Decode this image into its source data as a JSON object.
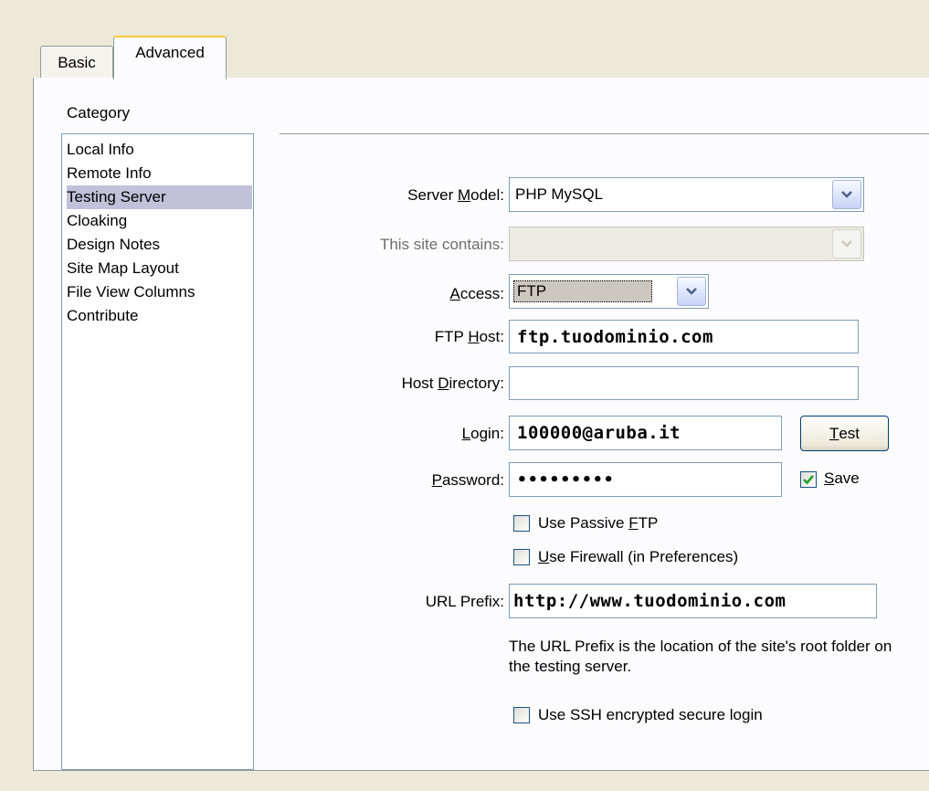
{
  "tabs": {
    "basic": "Basic",
    "advanced": "Advanced"
  },
  "category": {
    "label": "Category",
    "items": [
      "Local Info",
      "Remote Info",
      "Testing Server",
      "Cloaking",
      "Design Notes",
      "Site Map Layout",
      "File View Columns",
      "Contribute"
    ],
    "selected": "Testing Server"
  },
  "form": {
    "server_model": {
      "label_pre": "Server ",
      "label_u": "M",
      "label_post": "odel:",
      "value": "PHP MySQL"
    },
    "site_contains": {
      "label": "This site contains:",
      "value": ""
    },
    "access": {
      "label_u": "A",
      "label_post": "ccess:",
      "value": "FTP"
    },
    "ftp_host": {
      "label_pre": "FTP ",
      "label_u": "H",
      "label_post": "ost:",
      "value": "ftp.tuodominio.com"
    },
    "host_directory": {
      "label_pre": "Host ",
      "label_u": "D",
      "label_post": "irectory:",
      "value": ""
    },
    "login": {
      "label_u": "L",
      "label_post": "ogin:",
      "value": "100000@aruba.it"
    },
    "test_button": {
      "label_u": "T",
      "label_post": "est"
    },
    "password": {
      "label_u": "P",
      "label_post": "assword:",
      "value": "•••••••••"
    },
    "save": {
      "label_u": "S",
      "label_post": "ave",
      "checked": true
    },
    "passive_ftp": {
      "label_pre": "Use Passive ",
      "label_u": "F",
      "label_post": "TP",
      "checked": false
    },
    "firewall": {
      "label_u": "U",
      "label_post": "se Firewall (in Preferences)",
      "checked": false
    },
    "url_prefix": {
      "label": "URL Prefix:",
      "value": "http://www.tuodominio.com"
    },
    "url_note": "The URL Prefix is the location of the site's root folder on the testing server.",
    "ssh": {
      "label": "Use SSH encrypted secure login",
      "checked": false
    }
  }
}
